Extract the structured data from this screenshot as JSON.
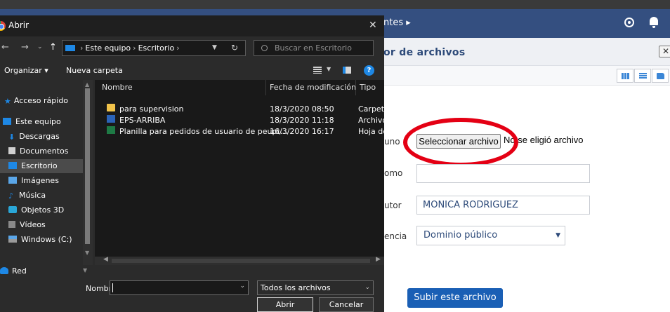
{
  "web": {
    "breadcrumb": "ntes ▸",
    "section_title": "or de archivos",
    "close_label": "✕",
    "form": {
      "file_label": "uno",
      "file_button": "Seleccionar archivo",
      "no_file": "No se eligió archivo",
      "volume_label": "omo",
      "volume_value": "",
      "author_label": "utor",
      "author_value": "MONICA RODRIGUEZ",
      "license_label": "encia",
      "license_value": "Dominio público",
      "submit_button": "Subir este archivo"
    },
    "colors": {
      "nav": "#344f80",
      "accent": "#1a5fb5",
      "highlight": "#e40014"
    }
  },
  "dialog": {
    "title": "Abrir",
    "close": "✕",
    "address": {
      "part1": "Este equipo",
      "part2": "Escritorio",
      "sep": "›"
    },
    "search_placeholder": "Buscar en Escritorio",
    "toolbar": {
      "organize": "Organizar ▾",
      "new_folder": "Nueva carpeta",
      "help": "?"
    },
    "nav": [
      {
        "label": "Acceso rápido",
        "icon": "star-icon"
      },
      {
        "label": "Este equipo",
        "icon": "pc-icon"
      },
      {
        "label": "Descargas",
        "icon": "download-icon"
      },
      {
        "label": "Documentos",
        "icon": "document-icon"
      },
      {
        "label": "Escritorio",
        "icon": "desktop-icon"
      },
      {
        "label": "Imágenes",
        "icon": "image-icon"
      },
      {
        "label": "Música",
        "icon": "music-icon"
      },
      {
        "label": "Objetos 3D",
        "icon": "cube-icon"
      },
      {
        "label": "Vídeos",
        "icon": "video-icon"
      },
      {
        "label": "Windows (C:)",
        "icon": "drive-icon"
      }
    ],
    "network": "Red",
    "columns": {
      "name": "Nombre",
      "date": "Fecha de modificación",
      "type": "Tipo"
    },
    "files": [
      {
        "name": "para supervision",
        "date": "18/3/2020 08:50",
        "type": "Carpeta",
        "icon": "folder-icon"
      },
      {
        "name": "EPS-ARRIBA",
        "date": "18/3/2020 11:18",
        "type": "Archivo",
        "icon": "word-file-icon"
      },
      {
        "name": "Planilla para pedidos de usuario de peupt…",
        "date": "16/3/2020 16:17",
        "type": "Hoja de",
        "icon": "excel-file-icon"
      }
    ],
    "bottom": {
      "name_label": "Nombre:",
      "name_value": "",
      "filetype": "Todos los archivos",
      "open": "Abrir",
      "cancel": "Cancelar"
    }
  }
}
